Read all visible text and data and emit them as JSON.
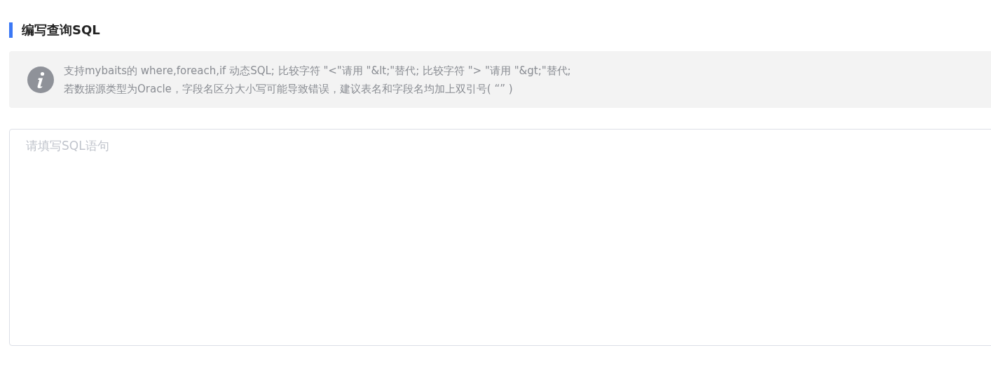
{
  "section": {
    "title": "编写查询SQL"
  },
  "notice": {
    "lines": [
      "支持mybaits的 where,foreach,if 动态SQL; 比较字符 \"<\"请用 \"&lt;\"替代; 比较字符 \"> \"请用 \"&gt;\"替代;",
      "若数据源类型为Oracle，字段名区分大小写可能导致错误，建议表名和字段名均加上双引号( “” )"
    ]
  },
  "sql_editor": {
    "placeholder": "请填写SQL语句"
  }
}
